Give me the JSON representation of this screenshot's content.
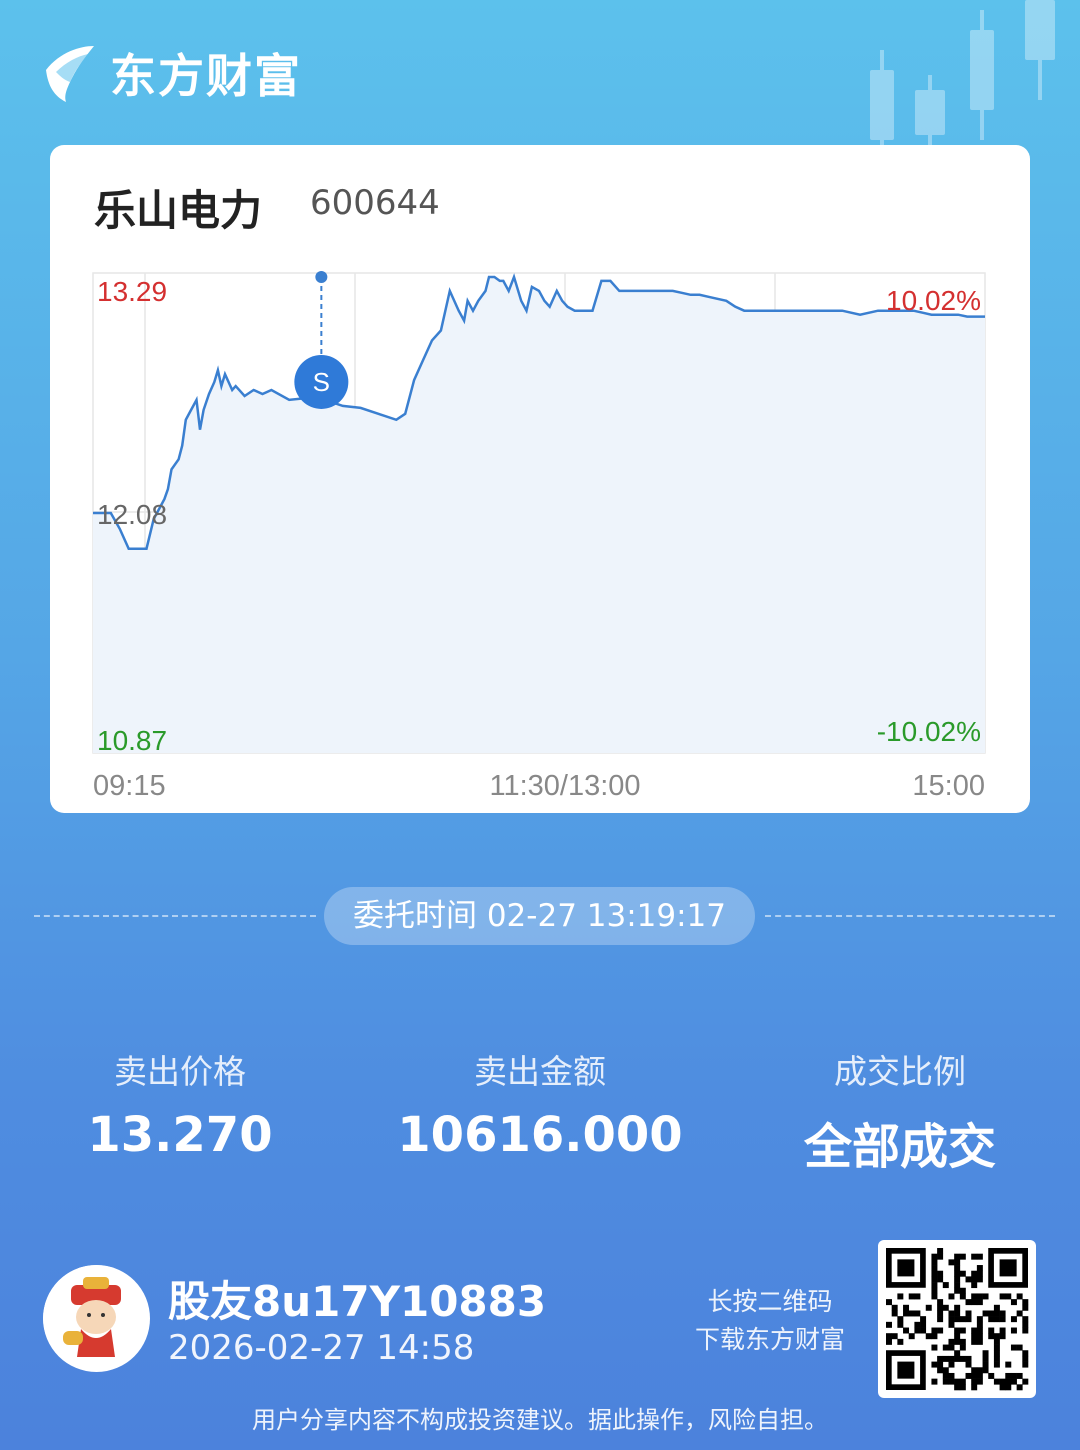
{
  "brand": {
    "name": "东方财富"
  },
  "stock": {
    "name": "乐山电力",
    "code": "600644"
  },
  "chart_data": {
    "type": "line",
    "ylim": [
      10.87,
      13.29
    ],
    "y_left_labels": {
      "top": "13.29",
      "mid": "12.08",
      "bottom": "10.87"
    },
    "y_right_labels": {
      "top": "10.02%",
      "bottom": "-10.02%"
    },
    "x_tick_labels": [
      "09:15",
      "11:30/13:00",
      "15:00"
    ],
    "marker": {
      "label": "S",
      "time_index": 128,
      "price": 13.27
    },
    "colors": {
      "line": "#3a7fd0",
      "fill": "#eef4fb",
      "up": "#d43030",
      "down": "#2a9a2a",
      "neutral": "#666666"
    },
    "series": [
      {
        "x": [
          0,
          10,
          15,
          20,
          25,
          30,
          34,
          40,
          42,
          44,
          48,
          50,
          52,
          55,
          58,
          60,
          62,
          65,
          68,
          70,
          72,
          74,
          78,
          80,
          85,
          90,
          95,
          100,
          110,
          120,
          130,
          140,
          150,
          160,
          170,
          175,
          180,
          185,
          190,
          195,
          200,
          205,
          208,
          210,
          213,
          216,
          220,
          222,
          225,
          228,
          230,
          233,
          236,
          240,
          243,
          246,
          250,
          253,
          256,
          260,
          263,
          266,
          270,
          275,
          280,
          285,
          290,
          295,
          300,
          305,
          310,
          315,
          320,
          325,
          330,
          335,
          340,
          345,
          350,
          355,
          360,
          365,
          370,
          380,
          390,
          400,
          410,
          420,
          430,
          440,
          445,
          450,
          455,
          460,
          465,
          470,
          475,
          480,
          485,
          490,
          495,
          500
        ],
        "y": [
          12.08,
          12.08,
          12.0,
          11.9,
          11.9,
          11.9,
          12.05,
          12.15,
          12.2,
          12.3,
          12.35,
          12.42,
          12.55,
          12.6,
          12.65,
          12.5,
          12.6,
          12.68,
          12.74,
          12.8,
          12.72,
          12.78,
          12.7,
          12.72,
          12.67,
          12.7,
          12.68,
          12.7,
          12.65,
          12.66,
          12.65,
          12.62,
          12.61,
          12.58,
          12.55,
          12.58,
          12.75,
          12.85,
          12.95,
          13.0,
          13.2,
          13.1,
          13.05,
          13.15,
          13.1,
          13.15,
          13.2,
          13.27,
          13.27,
          13.25,
          13.25,
          13.2,
          13.27,
          13.15,
          13.1,
          13.22,
          13.2,
          13.15,
          13.12,
          13.2,
          13.15,
          13.12,
          13.1,
          13.1,
          13.1,
          13.25,
          13.25,
          13.2,
          13.2,
          13.2,
          13.2,
          13.2,
          13.2,
          13.2,
          13.19,
          13.18,
          13.18,
          13.17,
          13.16,
          13.15,
          13.12,
          13.1,
          13.1,
          13.1,
          13.1,
          13.1,
          13.1,
          13.1,
          13.08,
          13.1,
          13.1,
          13.1,
          13.1,
          13.1,
          13.09,
          13.08,
          13.08,
          13.08,
          13.08,
          13.07,
          13.07,
          13.07
        ]
      }
    ]
  },
  "entrust": {
    "text": "委托时间 02-27 13:19:17"
  },
  "stats": [
    {
      "label": "卖出价格",
      "value": "13.270"
    },
    {
      "label": "卖出金额",
      "value": "10616.000"
    },
    {
      "label": "成交比例",
      "value": "全部成交"
    }
  ],
  "user": {
    "name": "股友8u17Y10883",
    "time": "2026-02-27 14:58"
  },
  "qr": {
    "hint_line1": "长按二维码",
    "hint_line2": "下载东方财富"
  },
  "disclaimer": "用户分享内容不构成投资建议。据此操作，风险自担。",
  "icons": {
    "brand": "eastmoney-logo-icon",
    "avatar": "caishen-avatar-icon",
    "qr": "qr-code-icon"
  }
}
